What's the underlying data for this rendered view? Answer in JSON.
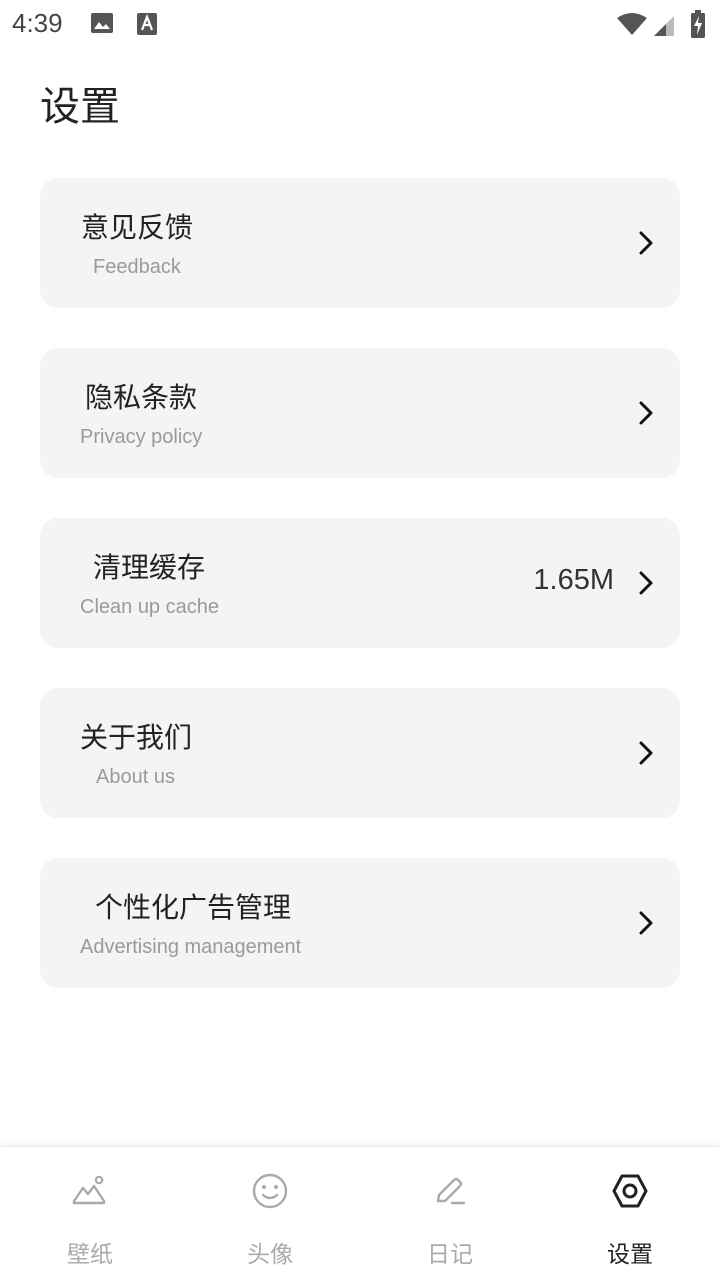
{
  "status_bar": {
    "time": "4:39"
  },
  "page": {
    "title": "设置"
  },
  "settings": [
    {
      "title": "意见反馈",
      "subtitle": "Feedback",
      "value": ""
    },
    {
      "title": "隐私条款",
      "subtitle": "Privacy policy",
      "value": ""
    },
    {
      "title": "清理缓存",
      "subtitle": "Clean up cache",
      "value": "1.65M"
    },
    {
      "title": "关于我们",
      "subtitle": "About us",
      "value": ""
    },
    {
      "title": "个性化广告管理",
      "subtitle": "Advertising management",
      "value": ""
    }
  ],
  "nav": [
    {
      "label": "壁纸",
      "icon": "mountain-icon",
      "active": false
    },
    {
      "label": "头像",
      "icon": "smiley-icon",
      "active": false
    },
    {
      "label": "日记",
      "icon": "pencil-icon",
      "active": false
    },
    {
      "label": "设置",
      "icon": "settings-hexagon-icon",
      "active": true
    }
  ],
  "colors": {
    "card_bg": "#f4f4f4",
    "active": "#222222",
    "inactive": "#aaaaaa"
  }
}
